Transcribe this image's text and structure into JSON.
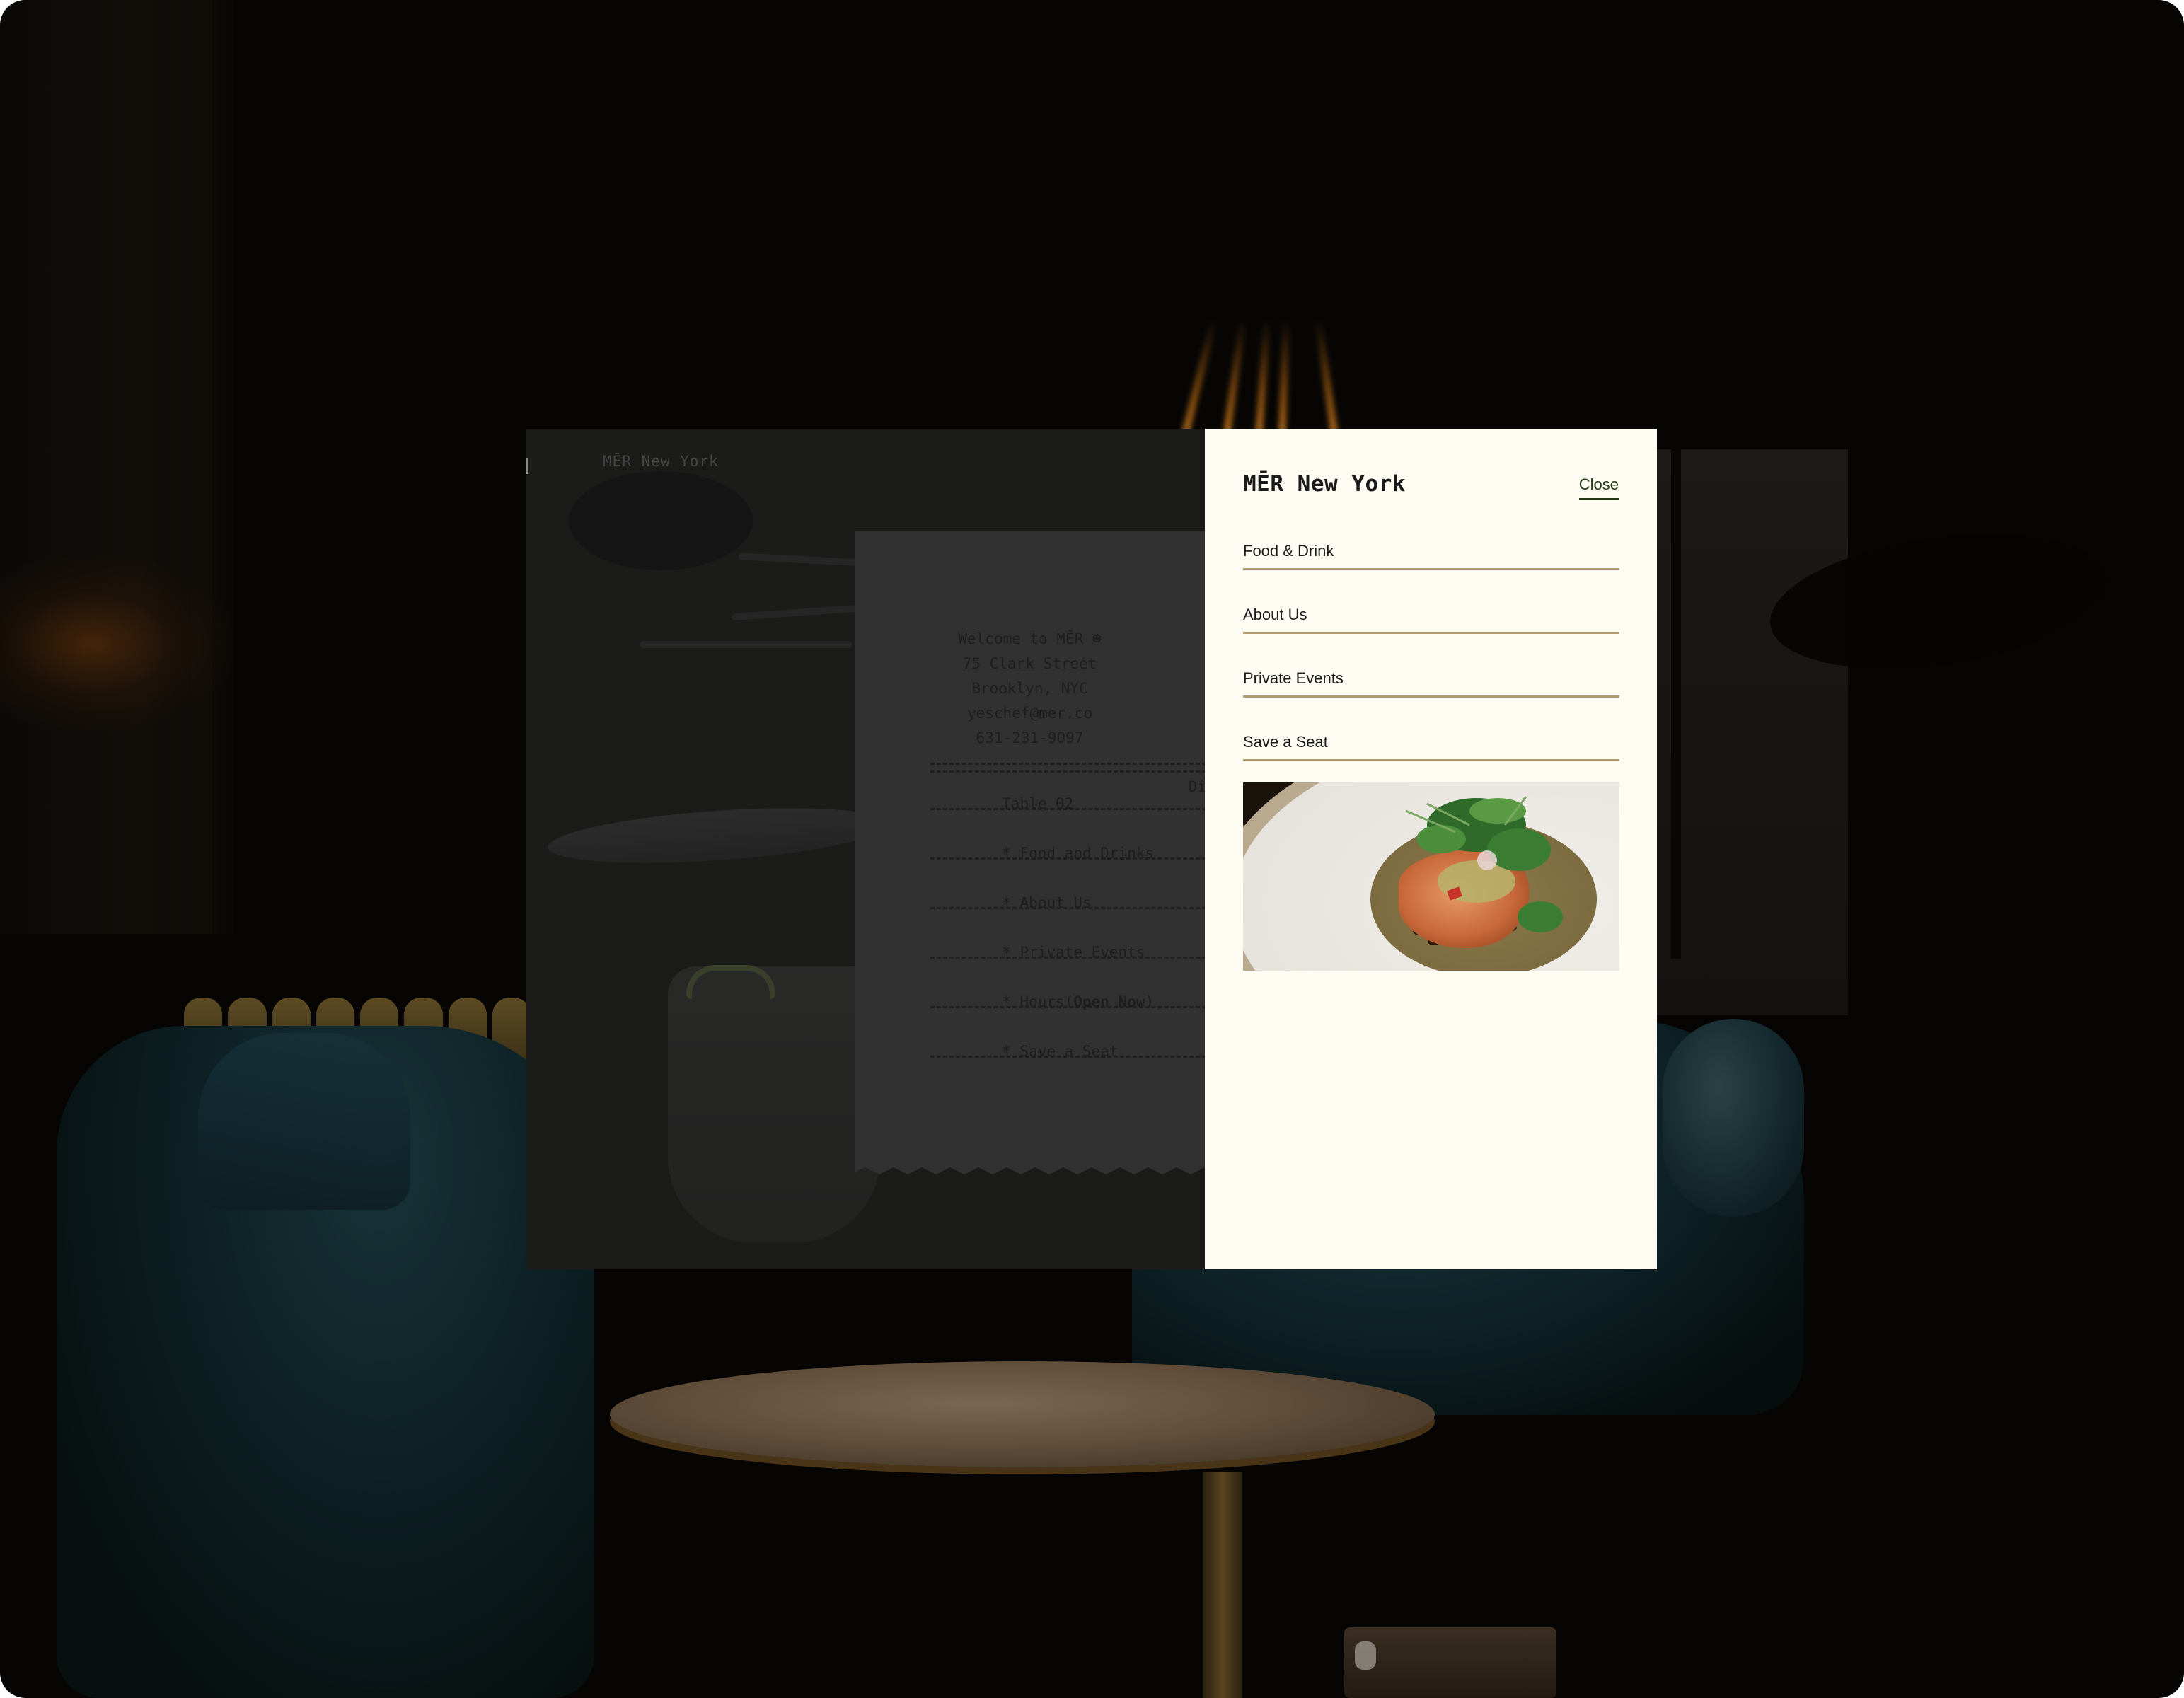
{
  "background": {
    "description": "dim restaurant lounge with velvet teal armchairs, round marble table and brass radiator"
  },
  "preview": {
    "brand": "MĒR New York",
    "receipt": {
      "header_lines": [
        "Welcome to MĒR ☻",
        "75 Clark Street",
        "Brooklyn, NYC",
        "yeschef@mer.co",
        "631-231-9097"
      ],
      "table_label": "Table 02",
      "table_right_label": "Di",
      "items": [
        {
          "bullet": "*",
          "label": "Food and Drinks"
        },
        {
          "bullet": "*",
          "label": "About Us"
        },
        {
          "bullet": "*",
          "label": "Private Events"
        },
        {
          "bullet": "*",
          "label": "Hours",
          "status": "Open Now"
        },
        {
          "bullet": "*",
          "label": "Save a Seat"
        }
      ]
    }
  },
  "panel": {
    "title": "MĒR New York",
    "close_label": "Close",
    "nav": [
      {
        "label": "Food & Drink"
      },
      {
        "label": "About Us"
      },
      {
        "label": "Private Events"
      },
      {
        "label": "Save a Seat"
      }
    ],
    "image_alt": "Plated crispy fish cake with greens and sauce"
  },
  "colors": {
    "panel_bg": "#fffcf4",
    "divider": "#b09a70",
    "close_accent": "#233a14",
    "receipt_bg": "#313131"
  }
}
